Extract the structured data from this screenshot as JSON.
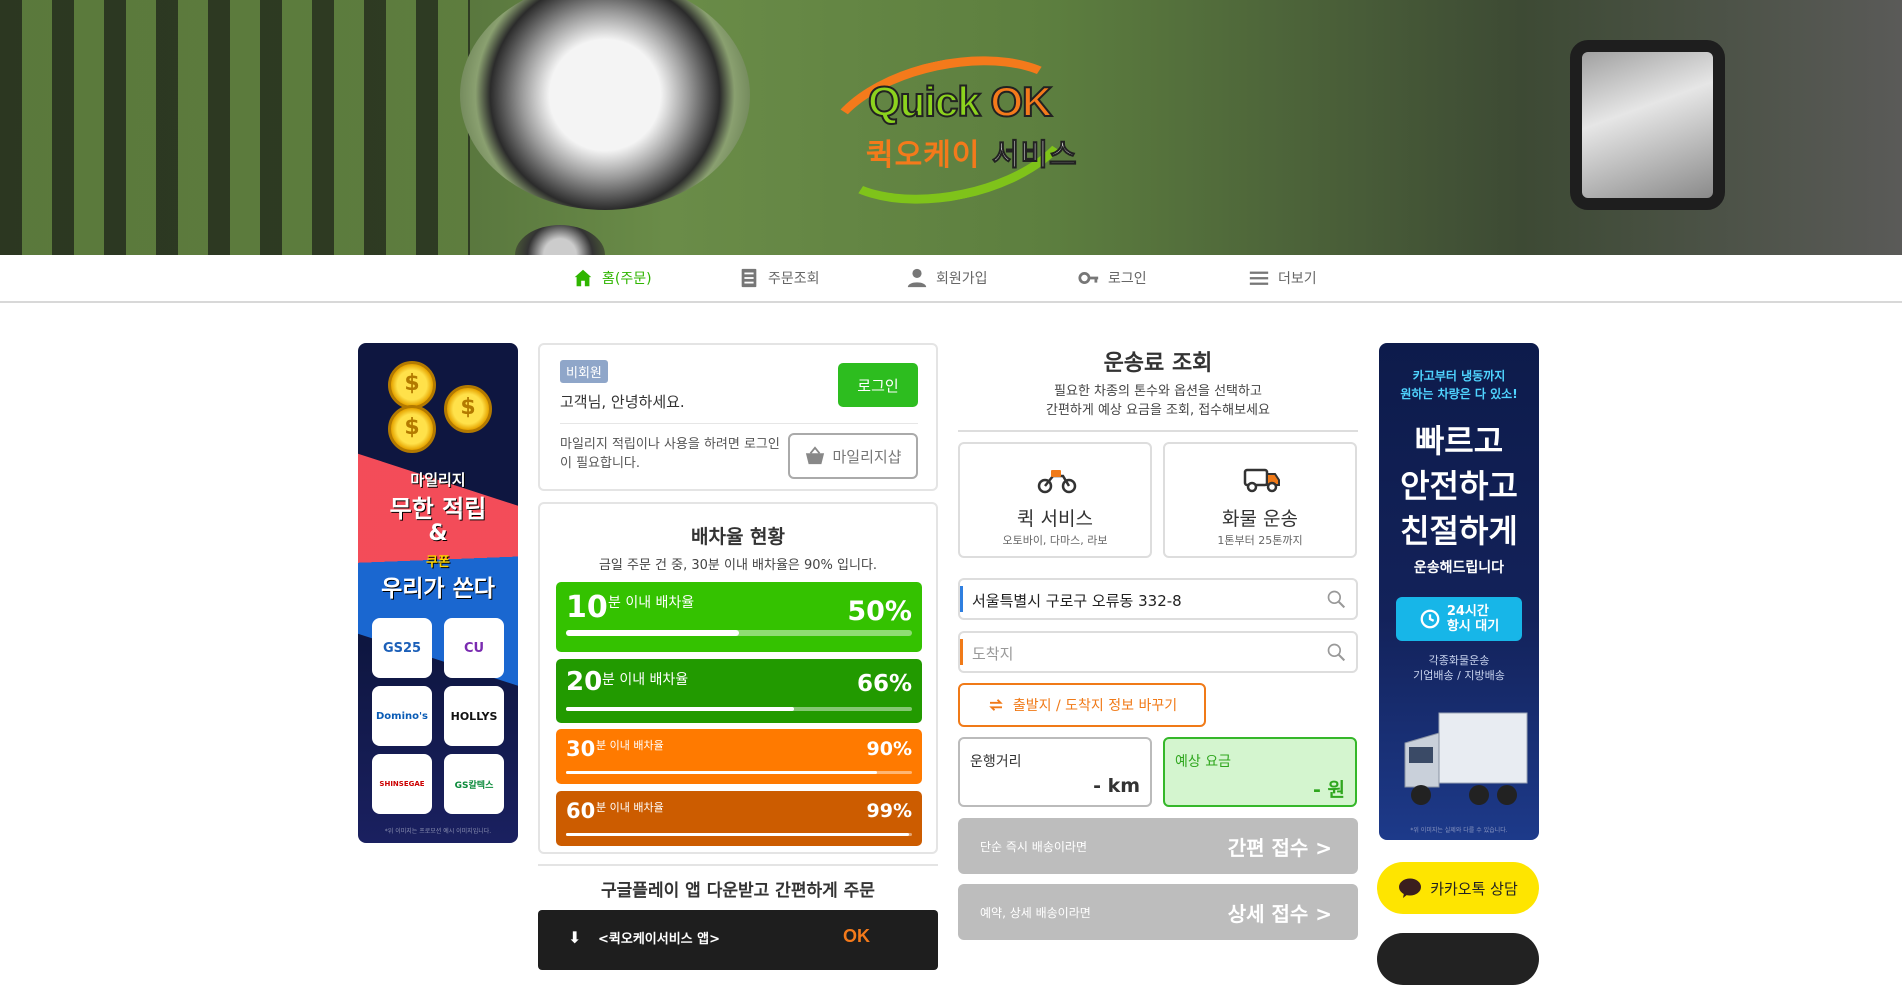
{
  "logo": {
    "quick": "Quick",
    "ok": "OK",
    "korean_a": "퀵오케이",
    "korean_b": " 서비스"
  },
  "nav": [
    {
      "label": "홈(주문)",
      "icon": "home-icon",
      "active": true
    },
    {
      "label": "주문조회",
      "icon": "list-icon",
      "active": false
    },
    {
      "label": "회원가입",
      "icon": "person-icon",
      "active": false
    },
    {
      "label": "로그인",
      "icon": "key-icon",
      "active": false
    },
    {
      "label": "더보기",
      "icon": "menu-icon",
      "active": false
    }
  ],
  "left_banner": {
    "line1": "마일리지",
    "line2": "무한 적립",
    "line3": "&",
    "line4": "쿠폰",
    "line5": "우리가 쏜다",
    "brands": [
      "GS25",
      "CU",
      "Domino's",
      "HOLLYS",
      "SHINSEGAE",
      "GS칼텍스"
    ],
    "footnote": "*위 이미지는 프로모션 예시 이미지입니다."
  },
  "member": {
    "badge": "비회원",
    "greeting": "고객님, 안녕하세요.",
    "login_label": "로그인",
    "mileage_note": "마일리지 적립이나 사용을 하려면 로그인이 필요합니다.",
    "mileage_shop_label": "마일리지샵"
  },
  "dispatch": {
    "title": "배차율 현황",
    "subtitle": "금일 주문 건 중, 30분 이내 배차율은 90% 입니다.",
    "rates": [
      {
        "minutes": "10",
        "label": "분 이내 배차율",
        "percent_text": "50%",
        "value": 0.5,
        "color": "#34c200"
      },
      {
        "minutes": "20",
        "label": "분 이내 배차율",
        "percent_text": "66%",
        "value": 0.66,
        "color": "#229a00"
      },
      {
        "minutes": "30",
        "label": "분 이내 배차율",
        "percent_text": "90%",
        "value": 0.9,
        "color": "#ff7a00"
      },
      {
        "minutes": "60",
        "label": "분 이내 배차율",
        "percent_text": "99%",
        "value": 0.99,
        "color": "#cc5c00"
      }
    ]
  },
  "googleplay": {
    "title": "구글플레이 앱 다운받고 간편하게 주문",
    "app_text": "<퀵오케이서비스 앱>",
    "ok": "OK"
  },
  "fare": {
    "title": "운송료 조회",
    "subtitle_1": "필요한 차종의 톤수와 옵션을 선택하고",
    "subtitle_2": "간편하게 예상 요금을 조회, 접수해보세요",
    "services": [
      {
        "name": "퀵 서비스",
        "desc": "오토바이, 다마스, 라보",
        "icon": "motorcycle-icon"
      },
      {
        "name": "화물 운송",
        "desc": "1톤부터 25톤까지",
        "icon": "truck-icon"
      }
    ],
    "origin_value": "서울특별시 구로구 오류동 332-8",
    "destination_placeholder": "도착지",
    "swap_label": "출발지 / 도착지 정보 바꾸기",
    "distance_label": "운행거리",
    "distance_value": "- km",
    "price_label": "예상 요금",
    "price_value": "- 원",
    "simple_sub": "단순 즉시 배송이라면",
    "simple_btn": "간편 접수 >",
    "detail_sub": "예약, 상세 배송이라면",
    "detail_btn": "상세 접수 >"
  },
  "right_banner": {
    "top_line1": "카고부터 냉동까지",
    "top_line2": "원하는 차량은 다 있소!",
    "big": [
      "빠르고",
      "안전하고",
      "친절하게"
    ],
    "small": "운송해드립니다",
    "badge_1": "24시간",
    "badge_2": "항시 대기",
    "svc_1": "각종화물운송",
    "svc_2": "기업배송 / 지방배송",
    "footnote": "*위 이미지는 실제와 다를 수 있습니다."
  },
  "kakao_label": "카카오톡 상담",
  "colors": {
    "brand_green": "#2dbd1f",
    "accent_orange": "#f07a18",
    "kakao_yellow": "#fee500"
  }
}
